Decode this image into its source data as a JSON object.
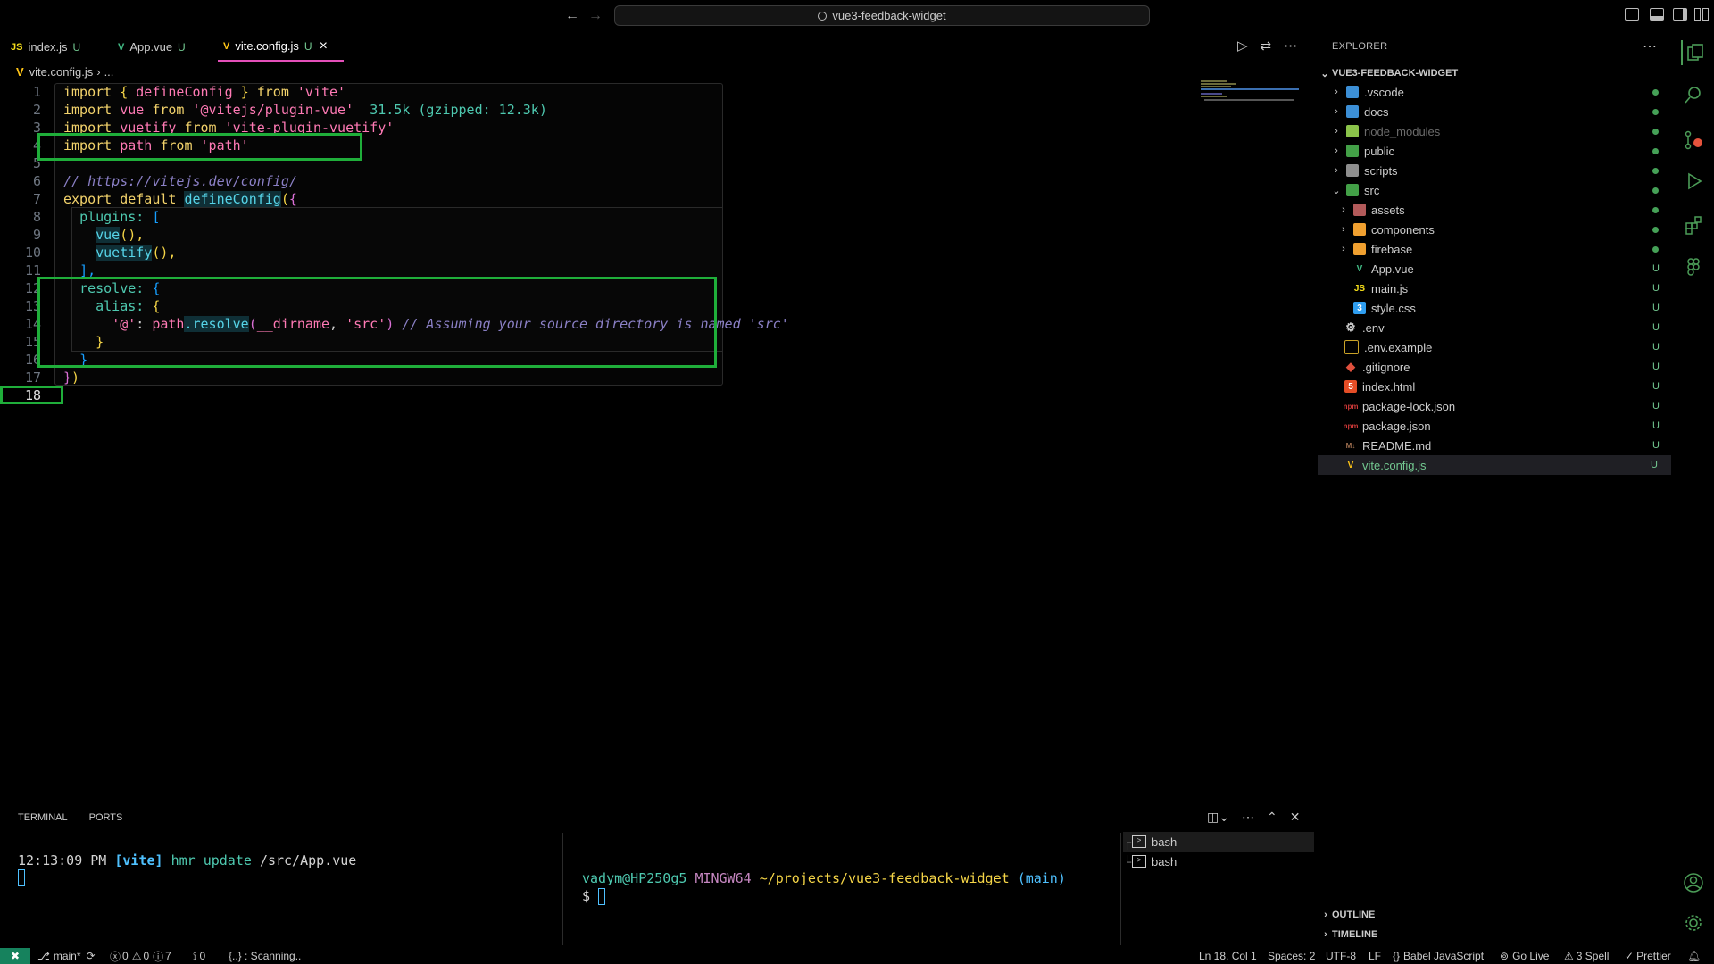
{
  "titlebar": {
    "search_text": "vue3-feedback-widget",
    "back_label": "←",
    "forward_label": "→"
  },
  "tabs": [
    {
      "icon": "JS",
      "label": "index.js",
      "status": "U"
    },
    {
      "icon": "V",
      "label": "App.vue",
      "status": "U"
    },
    {
      "icon": "V",
      "label": "vite.config.js",
      "status": "U",
      "close": "×"
    }
  ],
  "editor_actions": {
    "run": "▷",
    "compare": "⇄",
    "more": "⋯"
  },
  "breadcrumb": {
    "file": "vite.config.js",
    "sep": "›",
    "rest": "..."
  },
  "code": {
    "line_numbers": [
      "1",
      "2",
      "3",
      "4",
      "5",
      "6",
      "7",
      "8",
      "9",
      "10",
      "11",
      "12",
      "13",
      "14",
      "15",
      "16",
      "17",
      "18"
    ],
    "l1": {
      "kw1": "import",
      "b1": "{",
      "id": " defineConfig ",
      "b2": "}",
      "kw2": "from",
      "str": "'vite'"
    },
    "l2": {
      "kw1": "import",
      "id": "vue",
      "kw2": "from",
      "str": "'@vitejs/plugin-vue'",
      "size": "31.5k (gzipped: 12.3k)"
    },
    "l3": {
      "kw1": "import",
      "id": "vuetify",
      "kw2": "from",
      "str": "'vite-plugin-vuetify'"
    },
    "l4": {
      "kw1": "import",
      "id": "path",
      "kw2": "from",
      "str": "'path'"
    },
    "l6": {
      "comment": "// https://vitejs.dev/config/"
    },
    "l7": {
      "kw1": "export",
      "kw2": "default",
      "fn": "defineConfig",
      "paren": "(",
      "brace": "{"
    },
    "l8": {
      "prop": "plugins:",
      "br": "["
    },
    "l9": {
      "fn": "vue",
      "tail": "(),"
    },
    "l10": {
      "fn": "vuetify",
      "tail": "(),"
    },
    "l11": {
      "br": "],"
    },
    "l12": {
      "prop": "resolve:",
      "br": "{"
    },
    "l13": {
      "prop": "alias:",
      "br": "{"
    },
    "l14": {
      "key": "'@'",
      "colon": ":",
      "obj": "path",
      "fn": ".resolve",
      "open": "(",
      "arg1": "__dirname",
      "comma": ",",
      "arg2": "'src'",
      "close": ")",
      "comment": "// Assuming your source directory is named 'src'"
    },
    "l15": {
      "br": "}"
    },
    "l16": {
      "br": "}"
    },
    "l17": {
      "br1": "}",
      "br2": ")"
    }
  },
  "explorer": {
    "title": "EXPLORER",
    "more": "⋯",
    "root": "VUE3-FEEDBACK-WIDGET",
    "items": [
      {
        "label": ".vscode",
        "badge": "",
        "icon_color": "#3c8fd6"
      },
      {
        "label": "docs",
        "badge": "",
        "icon_color": "#3c8fd6"
      },
      {
        "label": "node_modules",
        "badge": "",
        "icon_color": "#8bc34a"
      },
      {
        "label": "public",
        "badge": "",
        "icon_color": "#43a047"
      },
      {
        "label": "scripts",
        "badge": "",
        "icon_color": "#8e8e8e"
      },
      {
        "label": "src",
        "badge": "",
        "icon_color": "#43a047"
      },
      {
        "label": "assets",
        "badge": "",
        "icon_color": "#b35a5a"
      },
      {
        "label": "components",
        "badge": "",
        "icon_color": "#f0a030"
      },
      {
        "label": "firebase",
        "badge": "",
        "icon_color": "#f0a030"
      },
      {
        "label": "App.vue",
        "badge": "U",
        "icon_color": "#41b883"
      },
      {
        "label": "main.js",
        "badge": "U",
        "icon_color": "#f5de19"
      },
      {
        "label": "style.css",
        "badge": "U",
        "icon_color": "#2f9ef0"
      },
      {
        "label": ".env",
        "badge": "U",
        "icon_color": "#cccccc"
      },
      {
        "label": ".env.example",
        "badge": "U",
        "icon_color": "#c9a227"
      },
      {
        "label": ".gitignore",
        "badge": "U",
        "icon_color": "#e0503d"
      },
      {
        "label": "index.html",
        "badge": "U",
        "icon_color": "#e44d26"
      },
      {
        "label": "package-lock.json",
        "badge": "U",
        "icon_color": "#cb3837"
      },
      {
        "label": "package.json",
        "badge": "U",
        "icon_color": "#cb3837"
      },
      {
        "label": "README.md",
        "badge": "U",
        "icon_color": "#a07050"
      },
      {
        "label": "vite.config.js",
        "badge": "U",
        "icon_color": "#ffc517"
      }
    ],
    "outline": "OUTLINE",
    "timeline": "TIMELINE"
  },
  "terminal": {
    "tabs": [
      "TERMINAL",
      "PORTS"
    ],
    "left": {
      "time": "12:13:09 PM",
      "tag": "[vite]",
      "msg": "hmr update",
      "path": "/src/App.vue"
    },
    "right": {
      "user": "vadym@HP250g5",
      "host": "MINGW64",
      "path": "~/projects/vue3-feedback-widget",
      "branch": "(main)",
      "prompt": "$"
    },
    "sessions": [
      "bash",
      "bash"
    ]
  },
  "status": {
    "remote": "✖",
    "branch": "main*",
    "errors": "0",
    "warnings": "0",
    "infos": "7",
    "ports": "0",
    "scanning": "{..} : Scanning..",
    "position": "Ln 18, Col 1",
    "spaces": "Spaces: 2",
    "encoding": "UTF-8",
    "eol": "LF",
    "language": "Babel JavaScript",
    "golive": "Go Live",
    "spell": "3 Spell",
    "prettier": "Prettier"
  },
  "colors": {
    "accent_green": "#1fae3a",
    "tab_underline": "#e44fb9",
    "modified": "#73c991"
  }
}
